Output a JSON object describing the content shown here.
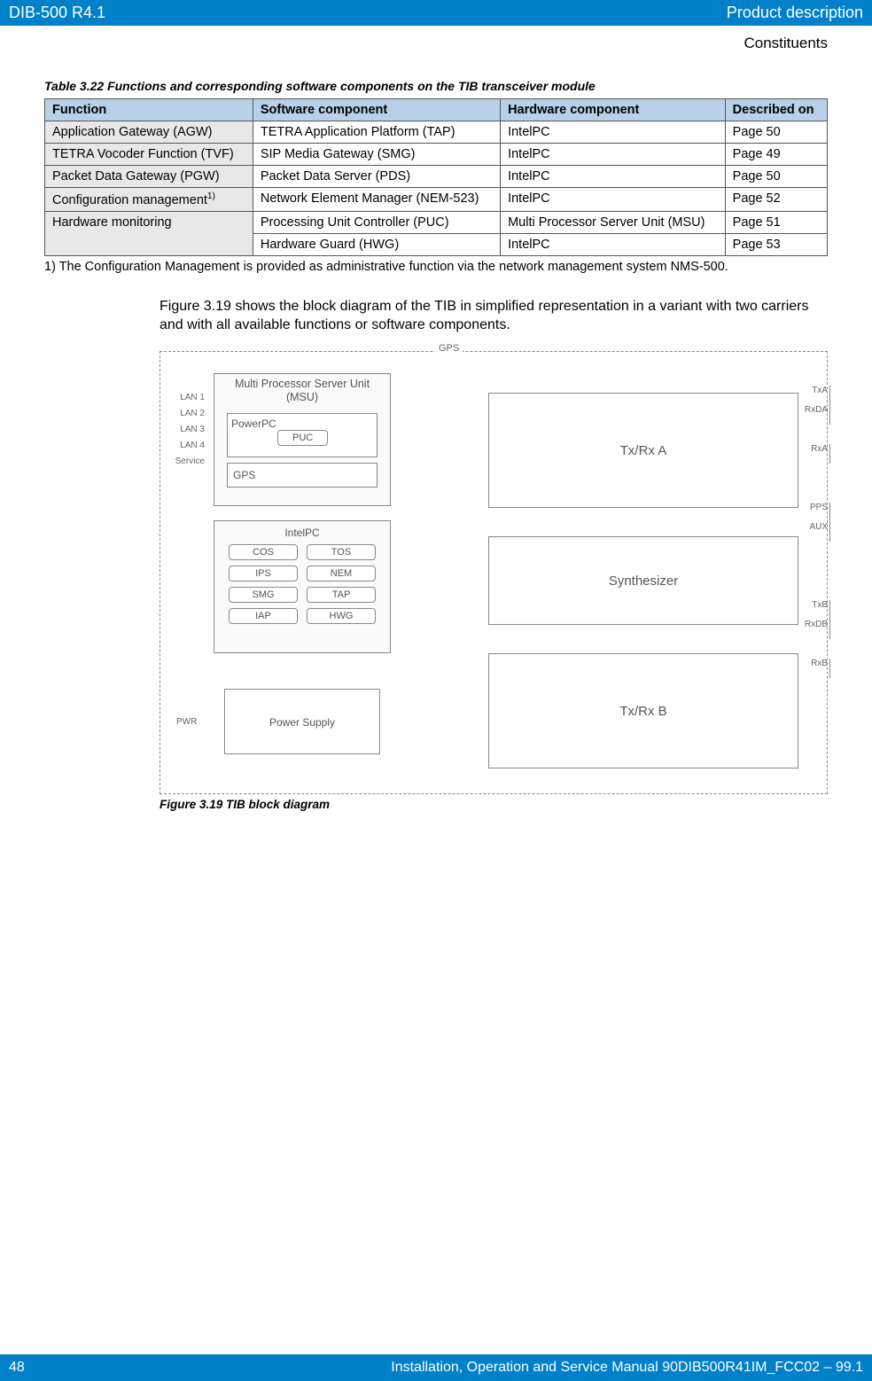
{
  "header": {
    "left": "DIB-500 R4.1",
    "right": "Product description",
    "sub": "Constituents"
  },
  "table": {
    "caption": "Table 3.22   Functions and corresponding software components on the TIB transceiver module",
    "headers": [
      "Function",
      "Software component",
      "Hardware component",
      "Described on"
    ],
    "rows": [
      {
        "fn": "Application Gateway (AGW)",
        "sw": "TETRA Application Platform (TAP)",
        "hw": "IntelPC",
        "pg": "Page 50"
      },
      {
        "fn": "TETRA Vocoder Function (TVF)",
        "sw": "SIP Media Gateway (SMG)",
        "hw": "IntelPC",
        "pg": "Page 49"
      },
      {
        "fn": "Packet Data Gateway (PGW)",
        "sw": "Packet Data Server (PDS)",
        "hw": "IntelPC",
        "pg": "Page 50"
      },
      {
        "fn_html": "Configuration management<sup>1)</sup>",
        "sw": "Network Element Manager (NEM-523)",
        "hw": "IntelPC",
        "pg": "Page 52"
      },
      {
        "fn": "Hardware monitoring",
        "sw": "Processing Unit Controller (PUC)",
        "hw": "Multi Processor Server Unit (MSU)",
        "pg": "Page 51",
        "rowspan_fn": 2
      },
      {
        "sw": "Hardware Guard (HWG)",
        "hw": "IntelPC",
        "pg": "Page 53"
      }
    ],
    "footnote": "1)  The Configuration Management is provided as administrative function via the network management system NMS-500."
  },
  "body_text": "Figure 3.19 shows the block diagram of the TIB in simplified representation in a variant with two carriers and with all available functions or software components.",
  "figure": {
    "caption": "Figure 3.19  TIB block diagram",
    "gps": "GPS",
    "left_ports": [
      "LAN 1",
      "LAN 2",
      "LAN 3",
      "LAN 4",
      "Service"
    ],
    "pwr": "PWR",
    "msu_title": "Multi Processor Server Unit\n(MSU)",
    "powerpc": "PowerPC",
    "puc": "PUC",
    "gpsbox": "GPS",
    "intelpc": "IntelPC",
    "chips": [
      "COS",
      "TOS",
      "IPS",
      "NEM",
      "SMG",
      "TAP",
      "IAP",
      "HWG"
    ],
    "psu": "Power Supply",
    "txrxa": "Tx/Rx A",
    "synth": "Synthesizer",
    "txrxb": "Tx/Rx B",
    "right_ports_a": [
      "TxA",
      "RxDA",
      "RxA"
    ],
    "right_ports_mid": [
      "PPS",
      "AUX"
    ],
    "right_ports_b": [
      "TxB",
      "RxDB",
      "RxB"
    ]
  },
  "footer": {
    "page": "48",
    "text": "Installation, Operation and Service Manual 90DIB500R41IM_FCC02 – 99.1"
  }
}
